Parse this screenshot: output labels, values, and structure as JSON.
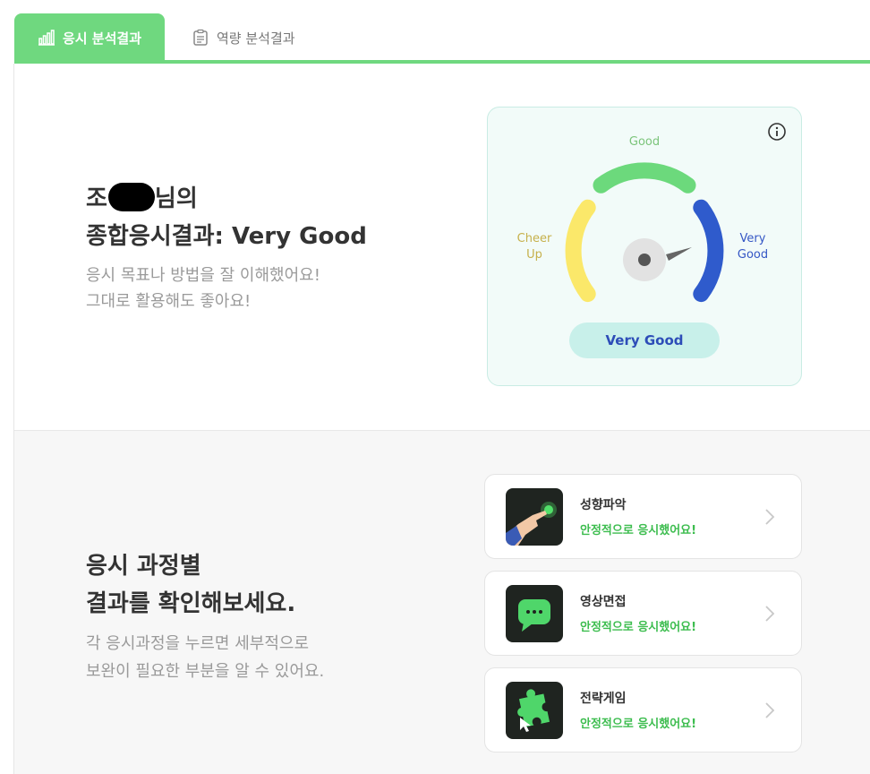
{
  "tabs": {
    "active_label": "응시 분석결과",
    "inactive_label": "역량 분석결과",
    "active_icon": "bar-chart-icon",
    "inactive_icon": "clipboard-icon"
  },
  "summary": {
    "name_prefix": "조",
    "name_suffix": "님의",
    "result_title": "종합응시결과: Very Good",
    "desc_line1": "응시 목표나 방법을 잘 이해했어요!",
    "desc_line2": "그대로 활용해도 좋아요!"
  },
  "gauge": {
    "label_good": "Good",
    "label_cheer_line1": "Cheer",
    "label_cheer_line2": "Up",
    "label_vgood_line1": "Very",
    "label_vgood_line2": "Good",
    "result": "Very Good",
    "colors": {
      "cheer": "#fbe86a",
      "good": "#6cd97c",
      "very_good": "#2f5bcc",
      "needle": "#666666"
    }
  },
  "process": {
    "title_line1": "응시 과정별",
    "title_line2": "결과를 확인해보세요.",
    "desc_line1": "각 응시과정을 누르면 세부적으로",
    "desc_line2": "보완이 필요한 부분을 알 수 있어요.",
    "items": [
      {
        "title": "성향파악",
        "status": "안정적으로 응시했어요!",
        "icon": "hand-pointing-icon"
      },
      {
        "title": "영상면접",
        "status": "안정적으로 응시했어요!",
        "icon": "chat-bubble-icon"
      },
      {
        "title": "전략게임",
        "status": "안정적으로 응시했어요!",
        "icon": "puzzle-icon"
      }
    ]
  }
}
